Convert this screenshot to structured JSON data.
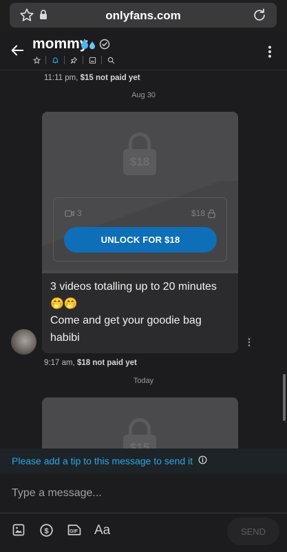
{
  "browser": {
    "url": "onlyfans.com"
  },
  "chat_header": {
    "name": "mommy"
  },
  "messages": [
    {
      "time": "11:11 pm,",
      "status": "$15 not paid yet"
    },
    {
      "date_divider": "Aug 30",
      "locked_price": "$18",
      "video_count": "3",
      "box_price": "$18",
      "unlock_label": "UNLOCK FOR $18",
      "text_line1": "3 videos totalling up to 20 minutes",
      "emoji": "🤭🤭",
      "text_line2": "Come and get your goodie bag",
      "text_line3": "habibi",
      "time": "9:17 am,",
      "status": "$18 not paid yet"
    },
    {
      "date_divider": "Today",
      "locked_price": "$15"
    }
  ],
  "tip_banner": {
    "text": "Please add a tip to this message to send it"
  },
  "composer": {
    "placeholder": "Type a message..."
  },
  "toolbar": {
    "text_format_label": "Aa",
    "send_label": "SEND"
  },
  "colors": {
    "accent": "#0e6fb8",
    "tip_text": "#2aa7e6",
    "background": "#1c1c1e"
  }
}
